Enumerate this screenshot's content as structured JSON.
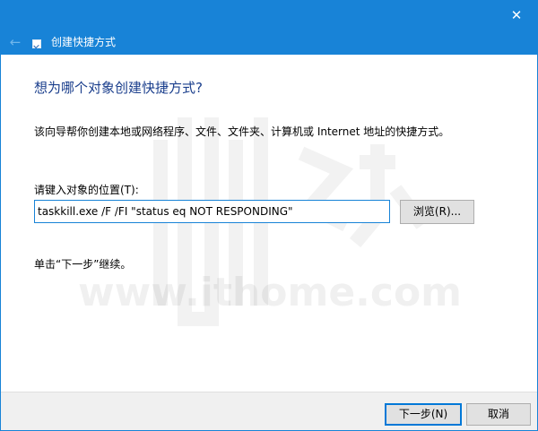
{
  "window": {
    "title": "创建快捷方式",
    "close_glyph": "✕",
    "back_glyph": "←"
  },
  "content": {
    "heading": "想为哪个对象创建快捷方式?",
    "description": "该向导帮你创建本地或网络程序、文件、文件夹、计算机或 Internet 地址的快捷方式。",
    "location_label": "请键入对象的位置(T):",
    "location_value": "taskkill.exe /F /FI \"status eq NOT RESPONDING\"",
    "browse_label": "浏览(R)...",
    "hint": "单击“下一步”继续。"
  },
  "footer": {
    "next_label": "下一步(N)",
    "cancel_label": "取消"
  },
  "watermark": {
    "text": "www.ithome.com"
  },
  "colors": {
    "accent": "#1883d7",
    "heading": "#1a3e8c",
    "footer_bg": "#f0f0f0"
  }
}
